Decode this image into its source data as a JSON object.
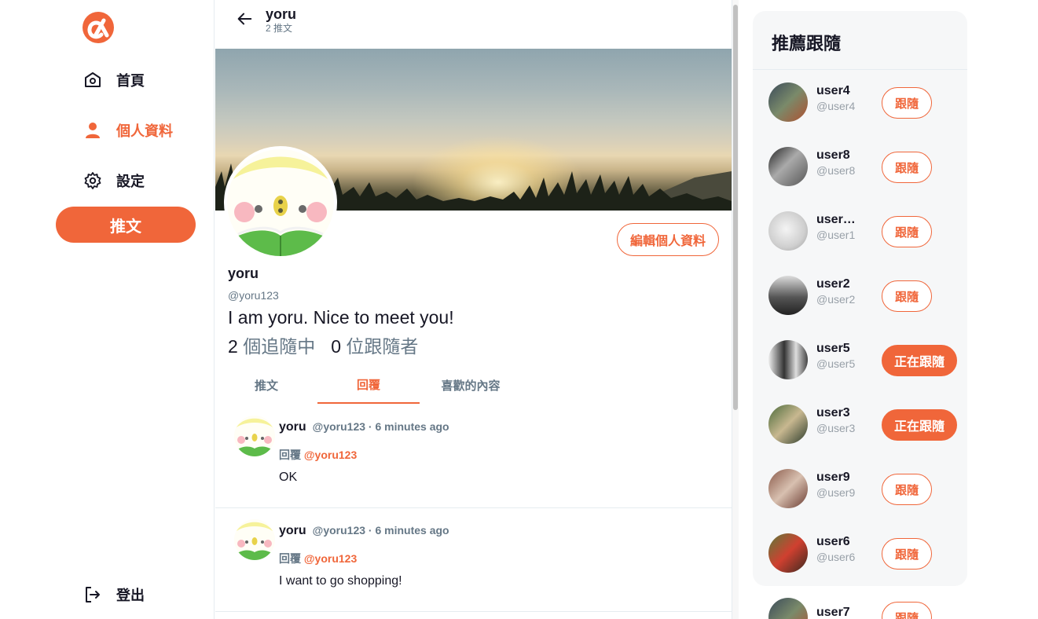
{
  "app": {
    "brand_color": "#f0663a",
    "logo_icon": "alpha-logo-icon"
  },
  "nav": {
    "items": [
      {
        "label": "首頁",
        "icon": "home-icon"
      },
      {
        "label": "個人資料",
        "icon": "person-icon",
        "active": true
      },
      {
        "label": "設定",
        "icon": "gear-icon"
      }
    ],
    "tweet_label": "推文",
    "logout_label": "登出"
  },
  "header": {
    "name": "yoru",
    "tweet_count": "2 推文"
  },
  "profile": {
    "name": "yoru",
    "handle": "@yoru123",
    "bio": "I am yoru. Nice to meet you!",
    "following_count": "2",
    "following_label": "個追隨中",
    "followers_count": "0",
    "followers_label": "位跟隨者",
    "edit_label": "編輯個人資料"
  },
  "tabs": [
    {
      "label": "推文",
      "active": false
    },
    {
      "label": "回覆",
      "active": true
    },
    {
      "label": "喜歡的內容",
      "active": false
    }
  ],
  "replies": [
    {
      "name": "yoru",
      "meta": "@yoru123 · 6 minutes ago",
      "reply_prefix": "回覆",
      "mention": "@yoru123",
      "text": "OK"
    },
    {
      "name": "yoru",
      "meta": "@yoru123 · 6 minutes ago",
      "reply_prefix": "回覆",
      "mention": "@yoru123",
      "text": "I want to go shopping!"
    }
  ],
  "suggestions": {
    "title": "推薦跟隨",
    "users": [
      {
        "name": "user4",
        "handle": "@user4",
        "button": "跟隨",
        "following": false
      },
      {
        "name": "user8",
        "handle": "@user8",
        "button": "跟隨",
        "following": false
      },
      {
        "name": "user…",
        "handle": "@user1",
        "button": "跟隨",
        "following": false
      },
      {
        "name": "user2",
        "handle": "@user2",
        "button": "跟隨",
        "following": false
      },
      {
        "name": "user5",
        "handle": "@user5",
        "button": "正在跟隨",
        "following": true
      },
      {
        "name": "user3",
        "handle": "@user3",
        "button": "正在跟隨",
        "following": true
      },
      {
        "name": "user9",
        "handle": "@user9",
        "button": "跟隨",
        "following": false
      },
      {
        "name": "user6",
        "handle": "@user6",
        "button": "跟隨",
        "following": false
      },
      {
        "name": "user7",
        "handle": "",
        "button": "跟隨",
        "following": false
      }
    ]
  }
}
